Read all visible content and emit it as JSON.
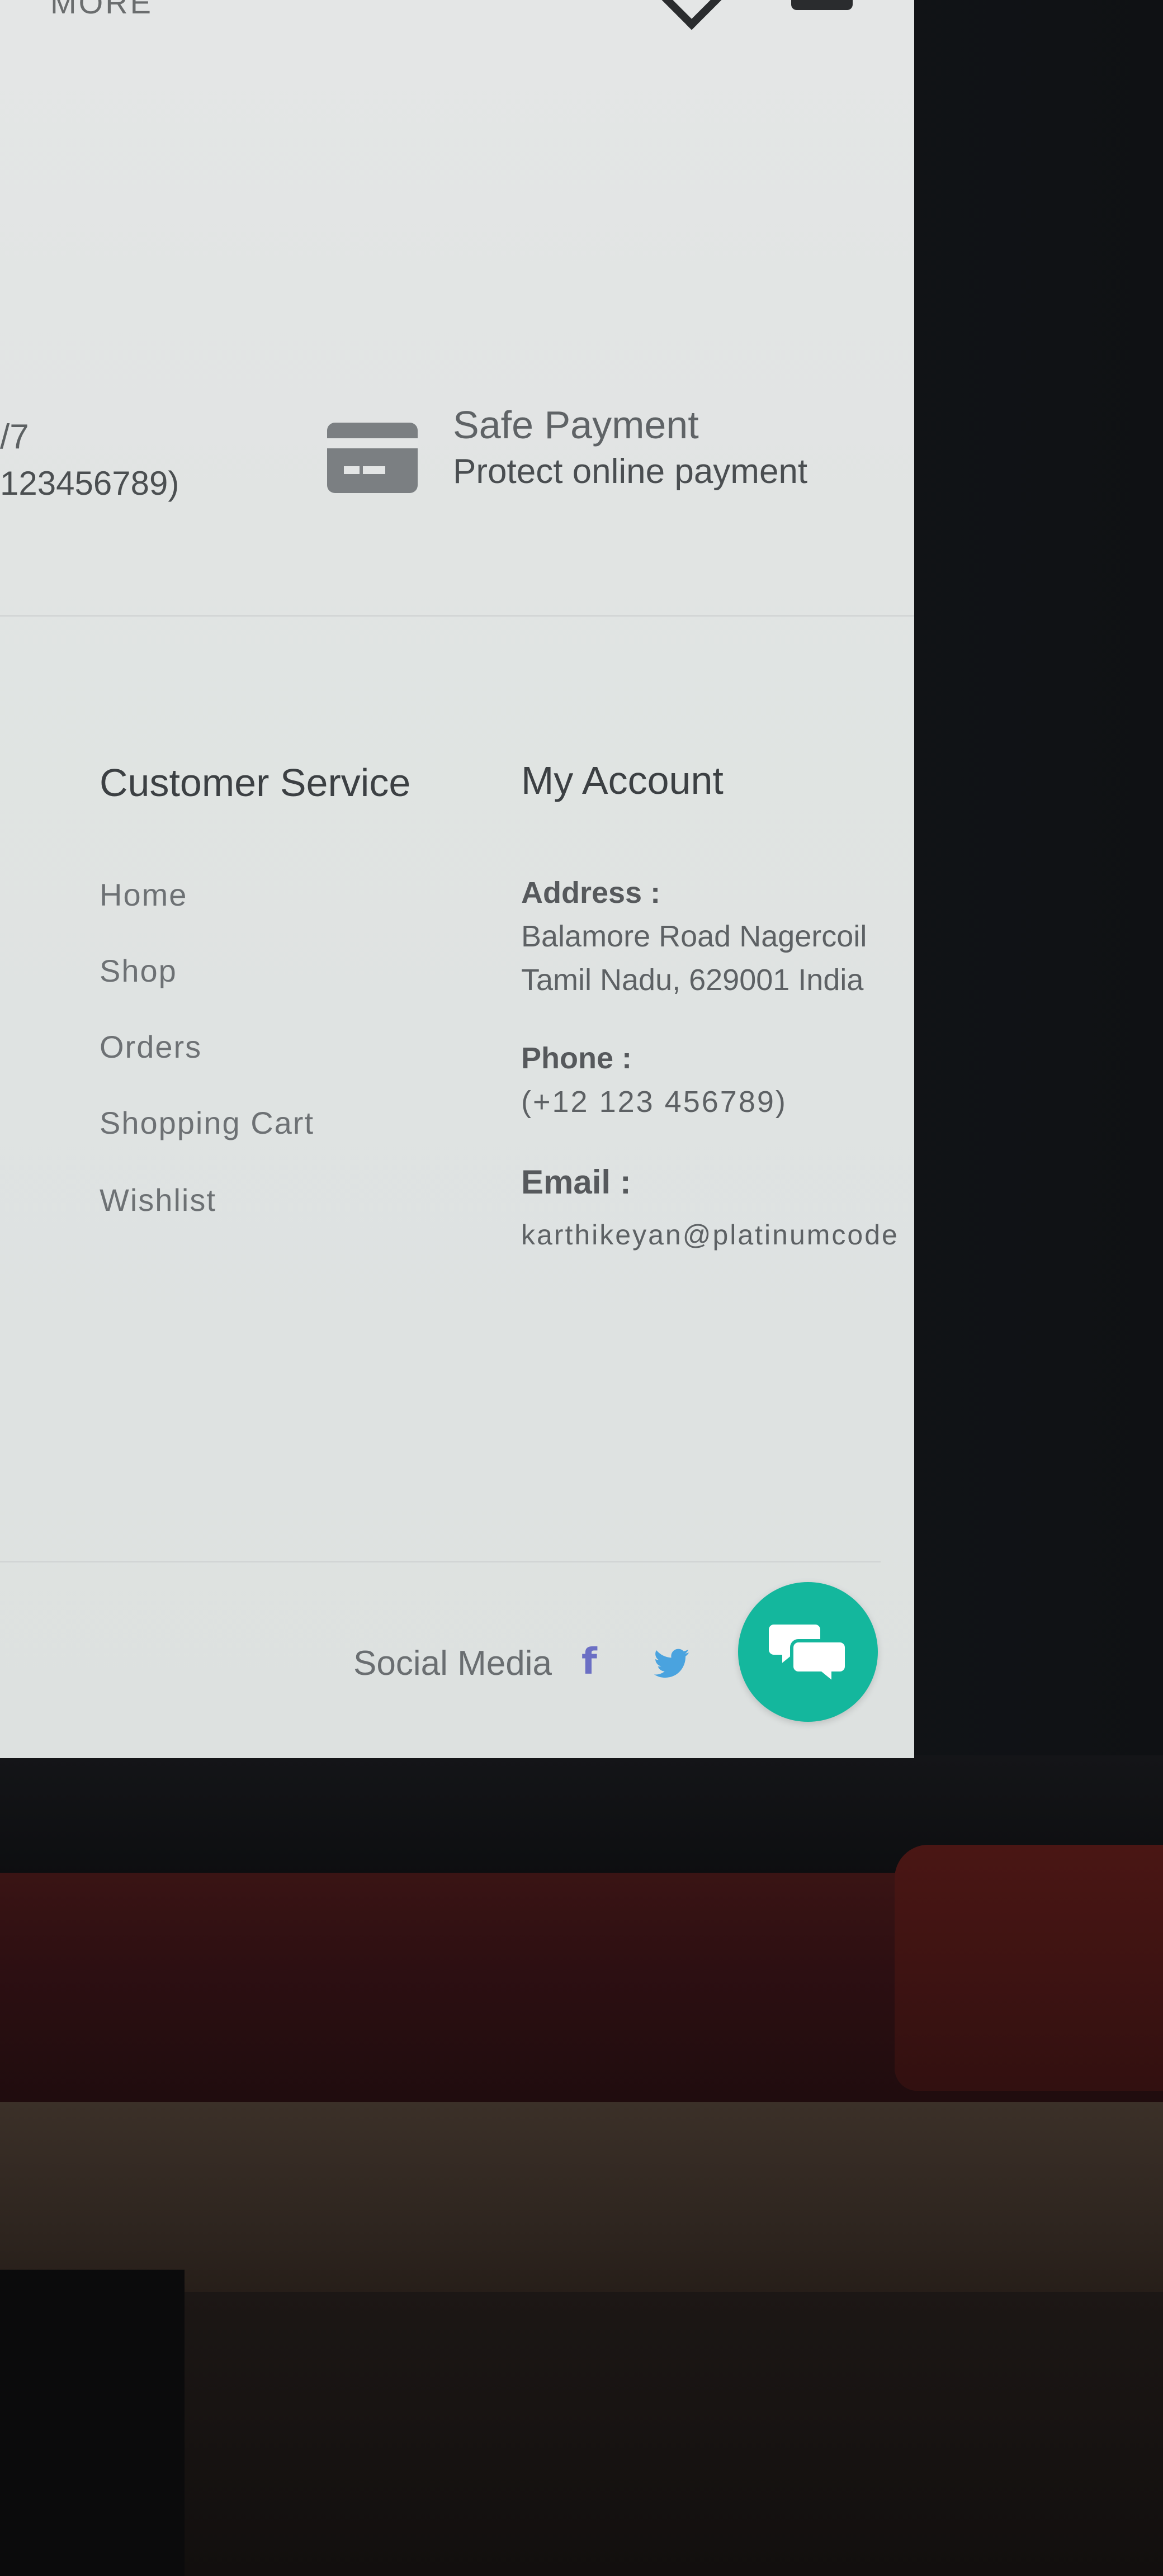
{
  "top": {
    "more_label": "MORE"
  },
  "features": {
    "left_partial_title": "/7",
    "left_partial_sub": "123456789)",
    "safe_payment": {
      "icon": "credit-card-icon",
      "title": "Safe Payment",
      "subtitle": "Protect online payment"
    }
  },
  "customer_service": {
    "heading": "Customer Service",
    "links": [
      "Home",
      "Shop",
      "Orders",
      "Shopping Cart",
      "Wishlist"
    ]
  },
  "my_account": {
    "heading": "My Account",
    "address_label": "Address :",
    "address_line1": "Balamore Road Nagercoil",
    "address_line2": "Tamil Nadu, 629001 India",
    "phone_label": "Phone :",
    "phone_value": "(+12 123 456789)",
    "email_label": "Email :",
    "email_value": "karthikeyan@platinumcode"
  },
  "footer": {
    "social_label": "Social Media",
    "facebook_glyph": "f",
    "icons": [
      "facebook-icon",
      "twitter-icon",
      "chat-icon"
    ]
  },
  "colors": {
    "chat_fab": "#14b79d",
    "facebook": "#6b6fc4",
    "twitter": "#4aa3df"
  }
}
